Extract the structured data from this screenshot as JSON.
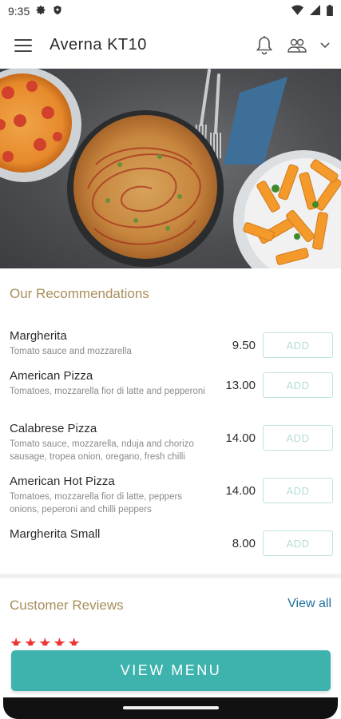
{
  "status_bar": {
    "time": "9:35",
    "icons": [
      "gear-icon",
      "shield-icon",
      "wifi-icon",
      "signal-icon",
      "battery-icon"
    ]
  },
  "header": {
    "title": "Averna  KT10",
    "icons": [
      "menu-icon",
      "bell-icon",
      "users-icon",
      "chevron-down-icon"
    ]
  },
  "hero": {
    "image": "pizza-and-pasta-photo"
  },
  "recommendations": {
    "title": "Our Recommendations",
    "items": [
      {
        "name": "Margherita",
        "description": "Tomato sauce and mozzarella",
        "price": "9.50",
        "button": "ADD"
      },
      {
        "name": "American Pizza",
        "description": "Tomatoes, mozzarella fior di latte and pepperoni",
        "price": "13.00",
        "button": "ADD"
      },
      {
        "name": "Calabrese Pizza",
        "description": "Tomato sauce, mozzarella, nduja and chorizo sausage, tropea onion, oregano, fresh chilli",
        "price": "14.00",
        "button": "ADD"
      },
      {
        "name": "American Hot Pizza",
        "description": "Tomatoes, mozzarella fior di latte, peppers onions, peperoni and chilli peppers",
        "price": "14.00",
        "button": "ADD"
      },
      {
        "name": "Margherita Small",
        "description": "",
        "price": "8.00",
        "button": "ADD"
      }
    ]
  },
  "reviews": {
    "title": "Customer Reviews",
    "view_all": "View all",
    "rating_stars": 5
  },
  "cta": {
    "label": "VIEW MENU"
  },
  "colors": {
    "accent": "#3eb3ae",
    "section_title": "#a88e5c",
    "link": "#1f6f9f",
    "add_border": "#bfe3df",
    "star": "#e33333"
  }
}
